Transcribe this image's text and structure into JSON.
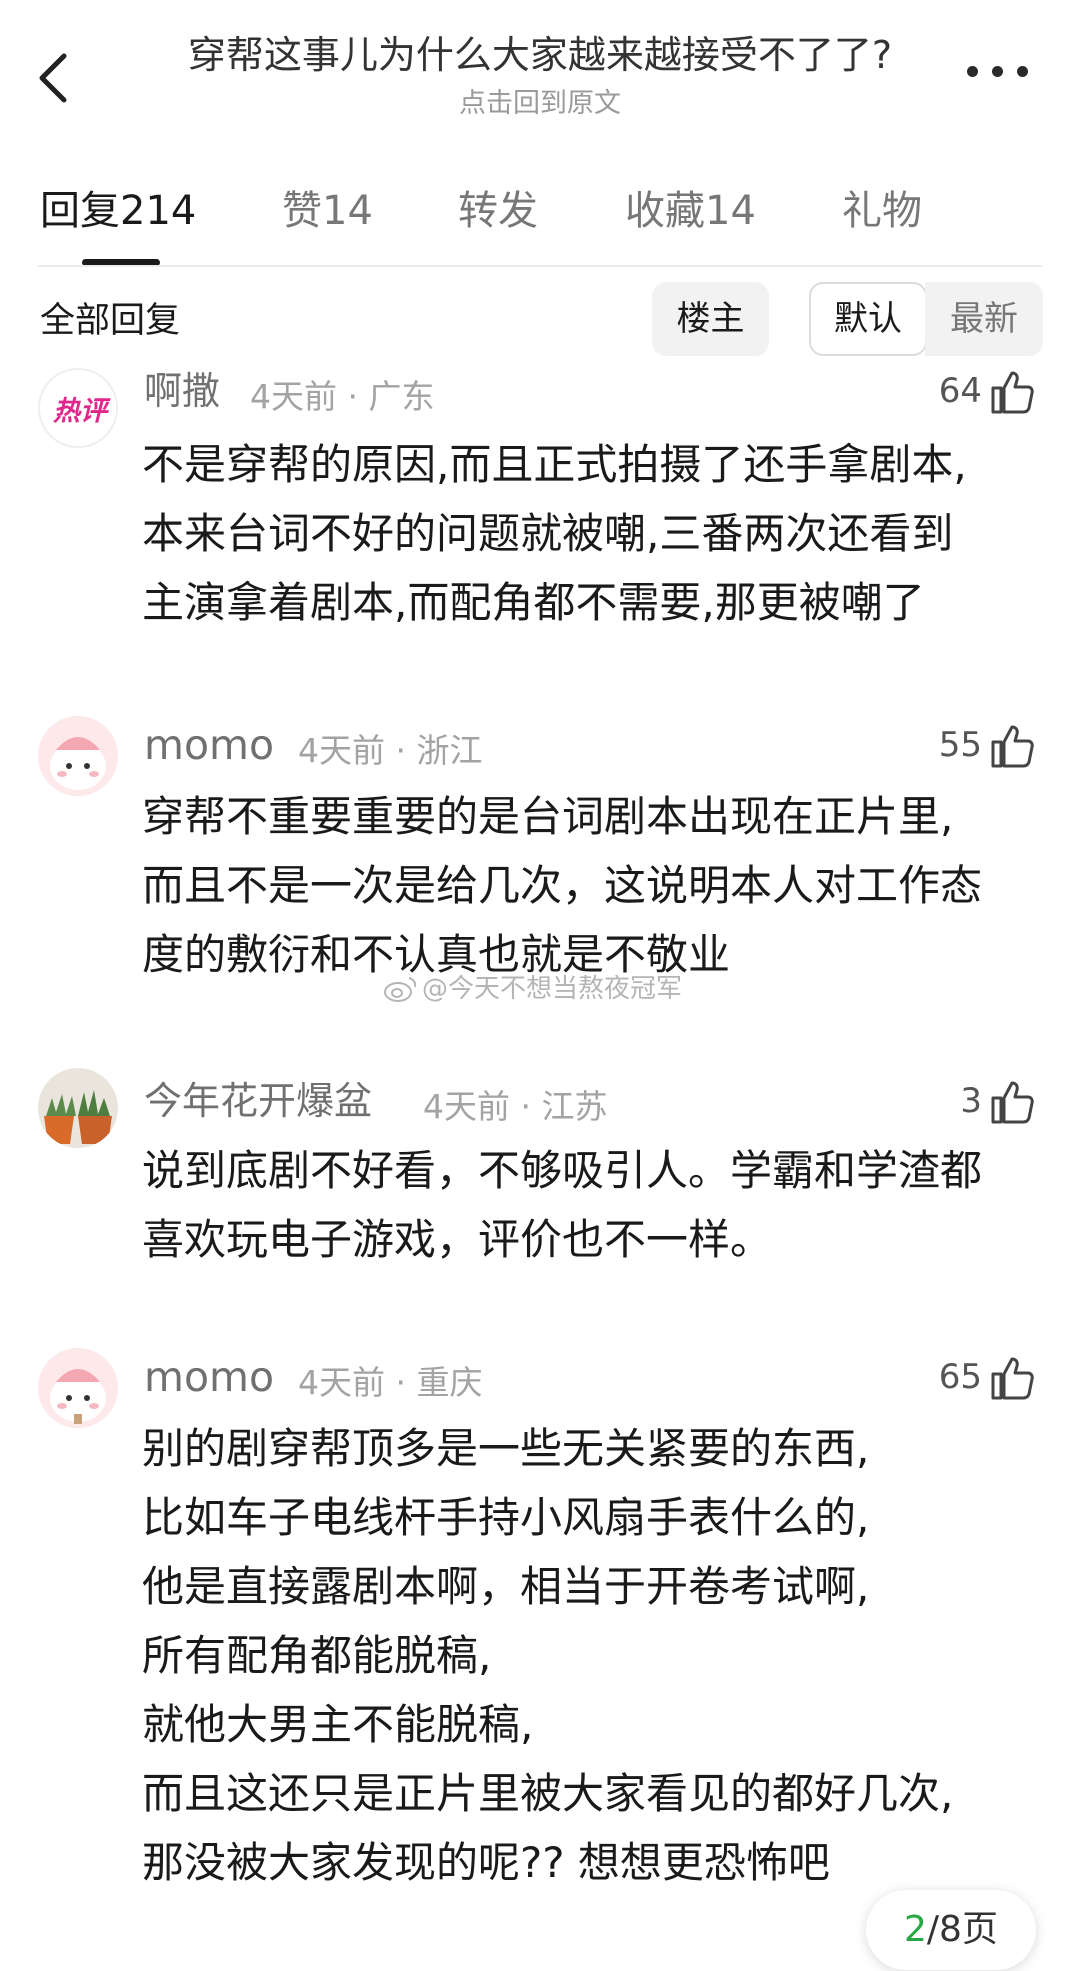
{
  "header": {
    "title": "穿帮这事儿为什么大家越来越接受不了了?",
    "subtitle": "点击回到原文"
  },
  "tabs": [
    {
      "label": "回复214",
      "active": true
    },
    {
      "label": "赞14",
      "active": false
    },
    {
      "label": "转发",
      "active": false
    },
    {
      "label": "收藏14",
      "active": false
    },
    {
      "label": "礼物",
      "active": false
    }
  ],
  "filter": {
    "label": "全部回复",
    "chips": [
      "楼主",
      "默认",
      "最新"
    ],
    "selected": "默认"
  },
  "comments": [
    {
      "user": "啊撒",
      "time": "4天前",
      "location": "广东",
      "likes": "64",
      "badge_text": "热评",
      "lines": [
        "不是穿帮的原因,而且正式拍摄了还手拿剧本,",
        "本来台词不好的问题就被嘲,三番两次还看到",
        "主演拿着剧本,而配角都不需要,那更被嘲了"
      ]
    },
    {
      "user": "momo",
      "time": "4天前",
      "location": "浙江",
      "likes": "55",
      "lines": [
        "穿帮不重要重要的是台词剧本出现在正片里,",
        "而且不是一次是给几次，这说明本人对工作态",
        "度的敷衍和不认真也就是不敬业"
      ]
    },
    {
      "user": "今年花开爆盆",
      "time": "4天前",
      "location": "江苏",
      "likes": "3",
      "lines": [
        "说到底剧不好看，不够吸引人。学霸和学渣都",
        "喜欢玩电子游戏，评价也不一样。"
      ]
    },
    {
      "user": "momo",
      "time": "4天前",
      "location": "重庆",
      "likes": "65",
      "lines": [
        "别的剧穿帮顶多是一些无关紧要的东西,",
        "比如车子电线杆手持小风扇手表什么的,",
        "他是直接露剧本啊，相当于开卷考试啊,",
        "所有配角都能脱稿,",
        "就他大男主不能脱稿,",
        "而且这还只是正片里被大家看见的都好几次,",
        "那没被大家发现的呢?? 想想更恐怖吧"
      ]
    }
  ],
  "watermark": "@今天不想当熬夜冠军",
  "pager": {
    "current": "2",
    "total": "/8页"
  },
  "icons": {
    "back": "chevron-left-icon",
    "more": "more-dots-icon",
    "like": "thumbs-up-icon",
    "watermark": "weibo-icon"
  },
  "colors": {
    "accent_green": "#28a745",
    "hot_badge": "#e0288c"
  }
}
